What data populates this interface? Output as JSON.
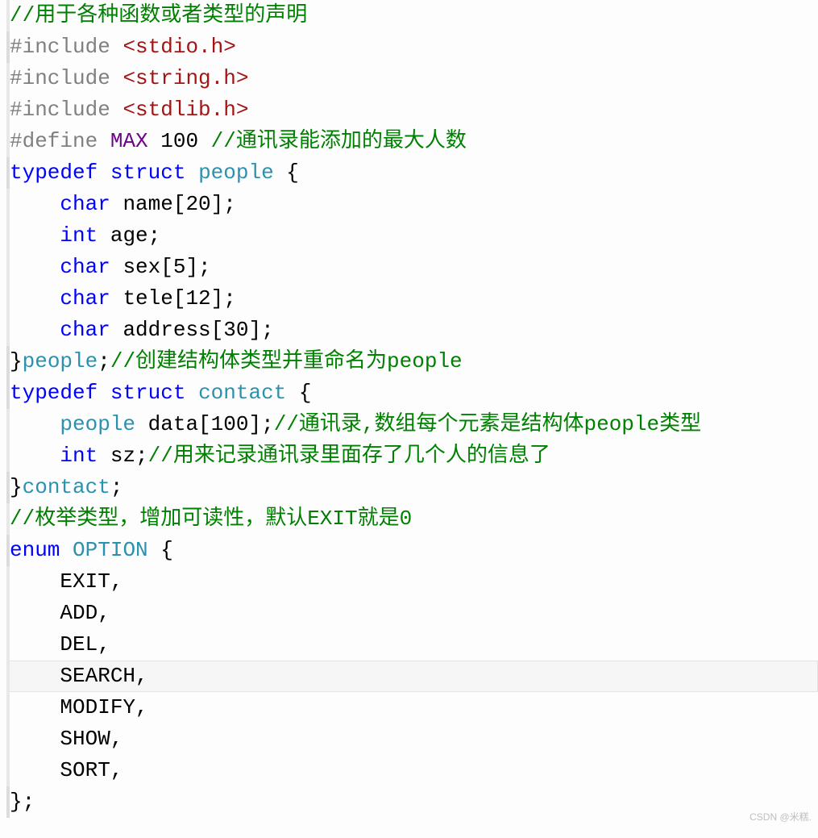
{
  "watermark": "CSDN @米糕.",
  "lines": [
    {
      "gutter": "1",
      "tokens": [
        {
          "c": "comment",
          "t": "//用于各种函数或者类型的声明"
        }
      ]
    },
    {
      "gutter": "0",
      "tokens": [
        {
          "c": "preproc",
          "t": "#include "
        },
        {
          "c": "angle",
          "t": "<"
        },
        {
          "c": "incfile",
          "t": "stdio.h"
        },
        {
          "c": "angle",
          "t": ">"
        }
      ]
    },
    {
      "gutter": "1",
      "tokens": [
        {
          "c": "preproc",
          "t": "#include "
        },
        {
          "c": "angle",
          "t": "<"
        },
        {
          "c": "incfile",
          "t": "string.h"
        },
        {
          "c": "angle",
          "t": ">"
        }
      ]
    },
    {
      "gutter": "1",
      "tokens": [
        {
          "c": "preproc",
          "t": "#include "
        },
        {
          "c": "angle",
          "t": "<"
        },
        {
          "c": "incfile",
          "t": "stdlib.h"
        },
        {
          "c": "angle",
          "t": ">"
        }
      ]
    },
    {
      "gutter": "1",
      "tokens": [
        {
          "c": "preproc",
          "t": "#define "
        },
        {
          "c": "macro",
          "t": "MAX"
        },
        {
          "c": "plain",
          "t": " 100 "
        },
        {
          "c": "comment",
          "t": "//通讯录能添加的最大人数"
        }
      ]
    },
    {
      "gutter": "0",
      "tokens": [
        {
          "c": "keyword",
          "t": "typedef"
        },
        {
          "c": "plain",
          "t": " "
        },
        {
          "c": "keyword",
          "t": "struct"
        },
        {
          "c": "plain",
          "t": " "
        },
        {
          "c": "typename",
          "t": "people"
        },
        {
          "c": "plain",
          "t": " {"
        }
      ]
    },
    {
      "gutter": "1",
      "tokens": [
        {
          "c": "plain",
          "t": "    "
        },
        {
          "c": "keyword",
          "t": "char"
        },
        {
          "c": "plain",
          "t": " name[20];"
        }
      ]
    },
    {
      "gutter": "1",
      "tokens": [
        {
          "c": "plain",
          "t": "    "
        },
        {
          "c": "keyword",
          "t": "int"
        },
        {
          "c": "plain",
          "t": " age;"
        }
      ]
    },
    {
      "gutter": "1",
      "tokens": [
        {
          "c": "plain",
          "t": "    "
        },
        {
          "c": "keyword",
          "t": "char"
        },
        {
          "c": "plain",
          "t": " sex[5];"
        }
      ]
    },
    {
      "gutter": "1",
      "tokens": [
        {
          "c": "plain",
          "t": "    "
        },
        {
          "c": "keyword",
          "t": "char"
        },
        {
          "c": "plain",
          "t": " tele[12];"
        }
      ]
    },
    {
      "gutter": "1",
      "tokens": [
        {
          "c": "plain",
          "t": "    "
        },
        {
          "c": "keyword",
          "t": "char"
        },
        {
          "c": "plain",
          "t": " address[30];"
        }
      ]
    },
    {
      "gutter": "0",
      "tokens": [
        {
          "c": "plain",
          "t": "}"
        },
        {
          "c": "typename",
          "t": "people"
        },
        {
          "c": "plain",
          "t": ";"
        },
        {
          "c": "comment",
          "t": "//创建结构体类型并重命名为people"
        }
      ]
    },
    {
      "gutter": "0",
      "tokens": [
        {
          "c": "keyword",
          "t": "typedef"
        },
        {
          "c": "plain",
          "t": " "
        },
        {
          "c": "keyword",
          "t": "struct"
        },
        {
          "c": "plain",
          "t": " "
        },
        {
          "c": "typename",
          "t": "contact"
        },
        {
          "c": "plain",
          "t": " {"
        }
      ]
    },
    {
      "gutter": "1",
      "tokens": [
        {
          "c": "plain",
          "t": "    "
        },
        {
          "c": "typename",
          "t": "people"
        },
        {
          "c": "plain",
          "t": " data[100];"
        },
        {
          "c": "comment",
          "t": "//通讯录,数组每个元素是结构体people类型"
        }
      ]
    },
    {
      "gutter": "1",
      "tokens": [
        {
          "c": "plain",
          "t": "    "
        },
        {
          "c": "keyword",
          "t": "int"
        },
        {
          "c": "plain",
          "t": " sz;"
        },
        {
          "c": "comment",
          "t": "//用来记录通讯录里面存了几个人的信息了"
        }
      ]
    },
    {
      "gutter": "0",
      "tokens": [
        {
          "c": "plain",
          "t": "}"
        },
        {
          "c": "typename",
          "t": "contact"
        },
        {
          "c": "plain",
          "t": ";"
        }
      ]
    },
    {
      "gutter": "1",
      "tokens": [
        {
          "c": "comment",
          "t": "//枚举类型，增加可读性，默认EXIT就是0"
        }
      ]
    },
    {
      "gutter": "0",
      "tokens": [
        {
          "c": "keyword",
          "t": "enum"
        },
        {
          "c": "plain",
          "t": " "
        },
        {
          "c": "typename",
          "t": "OPTION"
        },
        {
          "c": "plain",
          "t": " {"
        }
      ]
    },
    {
      "gutter": "1",
      "tokens": [
        {
          "c": "plain",
          "t": "    EXIT,"
        }
      ]
    },
    {
      "gutter": "1",
      "tokens": [
        {
          "c": "plain",
          "t": "    ADD,"
        }
      ]
    },
    {
      "gutter": "1",
      "tokens": [
        {
          "c": "plain",
          "t": "    DEL,"
        }
      ]
    },
    {
      "gutter": "1",
      "hl": true,
      "tokens": [
        {
          "c": "plain",
          "t": "    SEARCH,"
        }
      ]
    },
    {
      "gutter": "1",
      "tokens": [
        {
          "c": "plain",
          "t": "    MODIFY,"
        }
      ]
    },
    {
      "gutter": "1",
      "tokens": [
        {
          "c": "plain",
          "t": "    SHOW,"
        }
      ]
    },
    {
      "gutter": "1",
      "tokens": [
        {
          "c": "plain",
          "t": "    SORT,"
        }
      ]
    },
    {
      "gutter": "0",
      "tokens": [
        {
          "c": "plain",
          "t": "};"
        }
      ]
    }
  ]
}
